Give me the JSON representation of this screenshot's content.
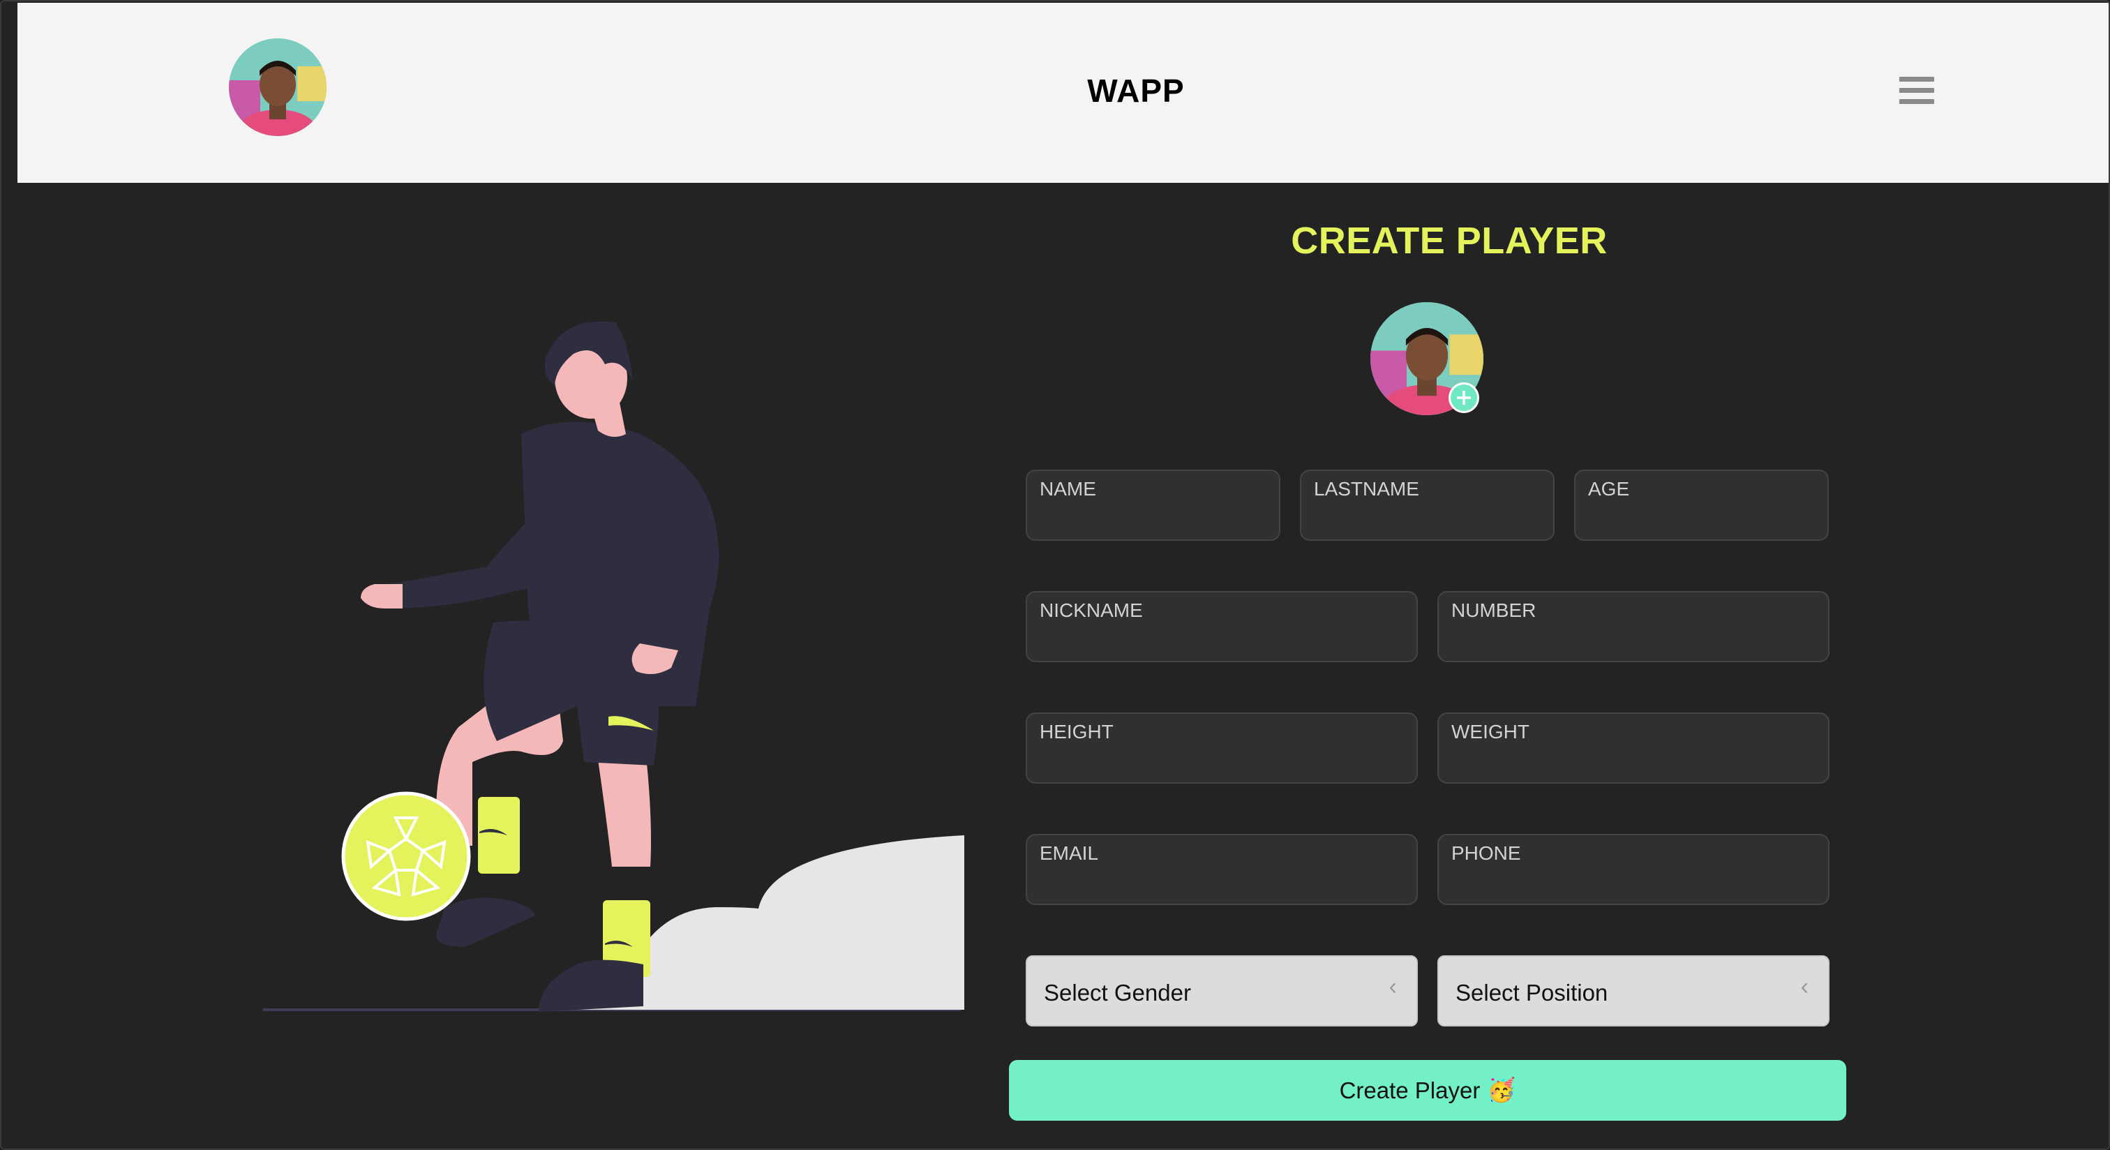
{
  "header": {
    "brand": "WAPP",
    "menu_icon": "hamburger-menu-icon",
    "avatar_icon": "user-avatar"
  },
  "form": {
    "title": "CREATE PLAYER",
    "photo_add_icon": "plus-icon",
    "fields": {
      "name": "NAME",
      "lastname": "LASTNAME",
      "age": "AGE",
      "nickname": "NICKNAME",
      "number": "NUMBER",
      "height": "HEIGHT",
      "weight": "WEIGHT",
      "email": "EMAIL",
      "phone": "PHONE"
    },
    "selects": {
      "gender": "Select Gender",
      "position": "Select Position"
    },
    "submit_label": "Create Player",
    "submit_emoji": "🥳"
  },
  "colors": {
    "accent": "#e4f25b",
    "button": "#73f0c8",
    "background": "#232323",
    "header_bg": "#f4f4f4",
    "figure_dark": "#2f2e41",
    "skin": "#f5b8b8",
    "ball": "#e4f25b"
  }
}
